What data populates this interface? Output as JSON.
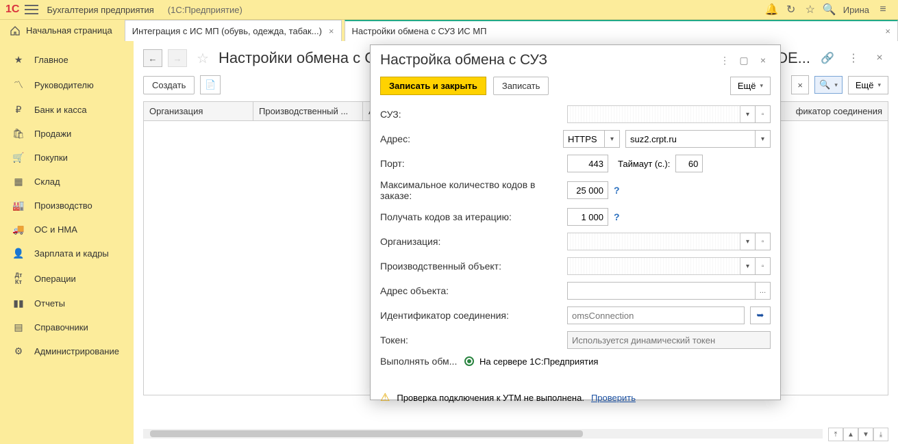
{
  "app": {
    "product": "Бухгалтерия предприятия",
    "platform": "(1С:Предприятие)",
    "user": "Ирина"
  },
  "tabs": {
    "home": "Начальная страница",
    "t1": "Интеграция с ИС МП (обувь, одежда, табак...)",
    "t2": "Настройки обмена с СУЗ ИС МП"
  },
  "sidebar": {
    "items": [
      {
        "icon": "★",
        "label": "Главное"
      },
      {
        "icon": "📈",
        "label": "Руководителю"
      },
      {
        "icon": "₽",
        "label": "Банк и касса"
      },
      {
        "icon": "🛍",
        "label": "Продажи"
      },
      {
        "icon": "🛒",
        "label": "Покупки"
      },
      {
        "icon": "▦",
        "label": "Склад"
      },
      {
        "icon": "🏭",
        "label": "Производство"
      },
      {
        "icon": "🚚",
        "label": "ОС и НМА"
      },
      {
        "icon": "👤",
        "label": "Зарплата и кадры"
      },
      {
        "icon": "Дт",
        "label": "Операции"
      },
      {
        "icon": "📊",
        "label": "Отчеты"
      },
      {
        "icon": "📕",
        "label": "Справочники"
      },
      {
        "icon": "⚙",
        "label": "Администрирование"
      }
    ]
  },
  "page": {
    "title": "Настройки обмена с СУЗ",
    "title_right": "EBDE...",
    "create_label": "Создать",
    "more_label": "Ещё",
    "columns": [
      "Организация",
      "Производственный ...",
      "А",
      "фикатор соединения"
    ]
  },
  "dialog": {
    "title": "Настройка обмена с СУЗ",
    "save_close": "Записать и закрыть",
    "save": "Записать",
    "more": "Ещё",
    "rows": {
      "suz": "СУЗ:",
      "addr": "Адрес:",
      "protocol": "HTTPS",
      "host": "suz2.crpt.ru",
      "port_lbl": "Порт:",
      "port": "443",
      "timeout_lbl": "Таймаут (с.):",
      "timeout": "60",
      "maxcodes_lbl": "Максимальное количество кодов в заказе:",
      "maxcodes": "25 000",
      "iter_lbl": "Получать кодов за итерацию:",
      "iter": "1 000",
      "org_lbl": "Организация:",
      "prod_lbl": "Производственный объект:",
      "objaddr_lbl": "Адрес объекта:",
      "connid_lbl": "Идентификатор соединения:",
      "connid_ph": "omsConnection",
      "token_lbl": "Токен:",
      "token_ph": "Используется динамический токен",
      "exec_lbl": "Выполнять обм...",
      "exec_opt": "На сервере 1С:Предприятия"
    },
    "warn": "Проверка подключения к УТМ не выполнена.",
    "warn_link": "Проверить"
  }
}
